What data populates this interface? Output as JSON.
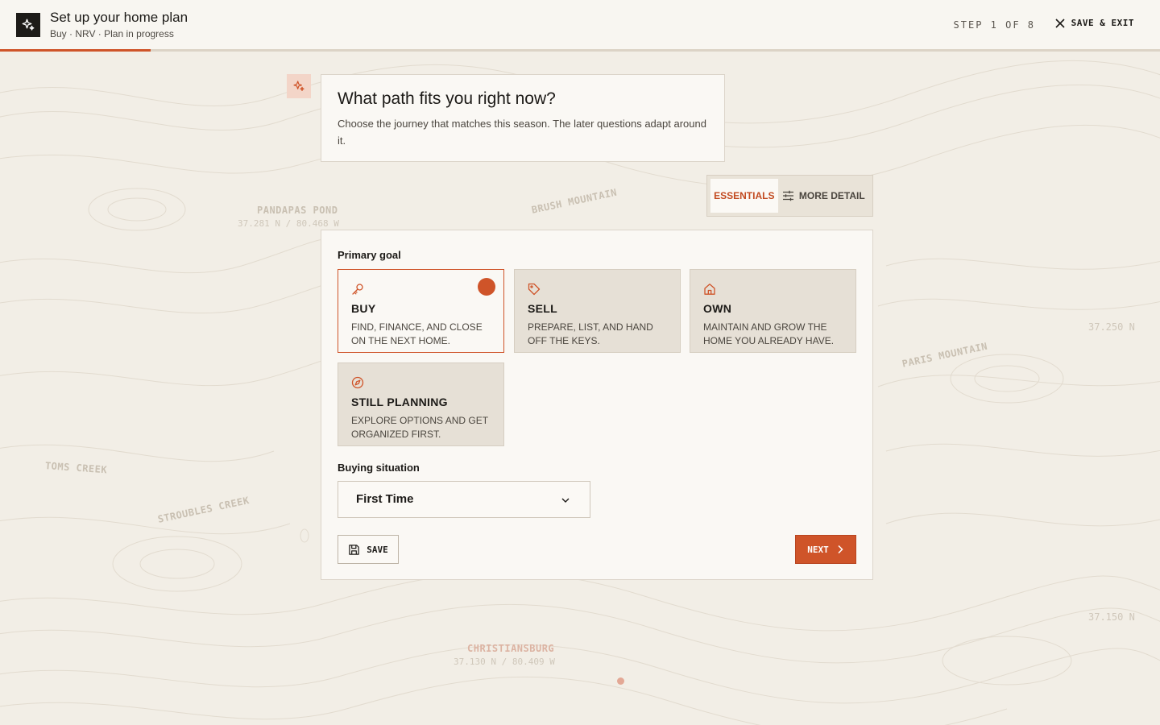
{
  "header": {
    "title": "Set up your home plan",
    "subtitle": "Buy · NRV · Plan in progress",
    "step": "STEP 1 OF 8",
    "exit_label": "SAVE & EXIT",
    "progress_fraction": 0.13,
    "brand_icon": "sparkle-icon"
  },
  "question": {
    "title": "What path fits you right now?",
    "subtitle": "Choose the journey that matches this season. The later questions adapt around it."
  },
  "mode": {
    "essentials_label": "ESSENTIALS",
    "more_detail_label": "MORE DETAIL",
    "active": "essentials"
  },
  "form": {
    "primary_goal_label": "Primary goal",
    "options": [
      {
        "title": "BUY",
        "desc": "Find, finance, and close on the next home.",
        "icon": "key-icon",
        "selected": true
      },
      {
        "title": "SELL",
        "desc": "Prepare, list, and hand off the keys.",
        "icon": "tag-icon",
        "selected": false
      },
      {
        "title": "OWN",
        "desc": "Maintain and grow the home you already have.",
        "icon": "home-icon",
        "selected": false
      },
      {
        "title": "STILL PLANNING",
        "desc": "Explore options and get organized first.",
        "icon": "compass-icon",
        "selected": false
      }
    ],
    "buying_situation_label": "Buying situation",
    "buying_situation_value": "First Time",
    "save_label": "SAVE",
    "next_label": "NEXT"
  },
  "map": {
    "labels": [
      {
        "name": "PANDAPAS POND",
        "coord": "37.281 N / 80.468 W"
      },
      {
        "name": "BRUSH MOUNTAIN"
      },
      {
        "name": "PARIS MOUNTAIN"
      },
      {
        "name": "TOMS CREEK"
      },
      {
        "name": "STROUBLES CREEK"
      },
      {
        "name": "CHRISTIANSBURG",
        "coord": "37.130 N / 80.409 W"
      }
    ],
    "edge_coords": [
      "37.250 N",
      "37.150 N"
    ]
  },
  "colors": {
    "accent": "#cf5429",
    "background": "#f2eee6",
    "card": "#faf8f4",
    "option_bg": "#e6e0d6"
  }
}
